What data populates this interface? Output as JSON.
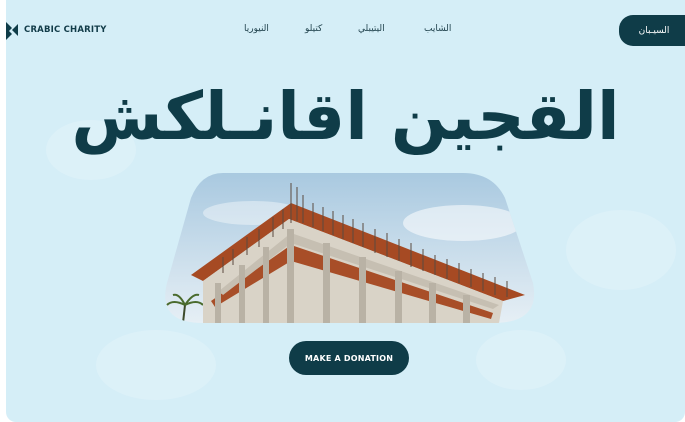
{
  "brand": {
    "name": "CRABIC CHARITY",
    "logo_icon": "brand-cross-icon"
  },
  "nav": {
    "items": [
      {
        "label": "النيوريا"
      },
      {
        "label": "كتيلو"
      },
      {
        "label": "اليتيبلي"
      },
      {
        "label": "الشايب"
      }
    ],
    "top_button": "السيـبان"
  },
  "hero": {
    "title": "القجين اقانـلكش",
    "image": "building-construction-image",
    "cta_label": "MAKE A DONATION"
  },
  "colors": {
    "accent": "#0f3c48",
    "background": "#d5eef7"
  }
}
